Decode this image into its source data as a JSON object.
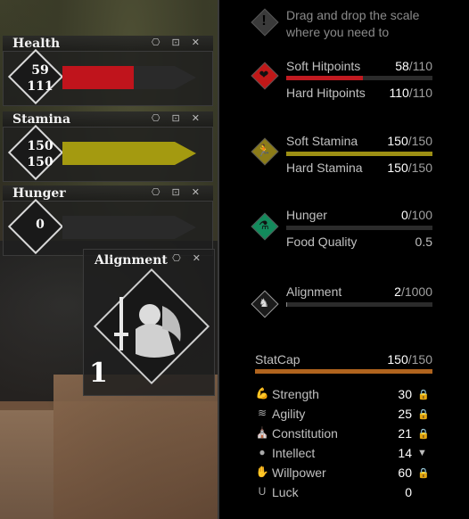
{
  "hud": {
    "health": {
      "title": "Health",
      "current": "59",
      "max": "111",
      "fill_fraction": 0.53,
      "color": "#c0141c"
    },
    "stamina": {
      "title": "Stamina",
      "current": "150",
      "max": "150",
      "fill_fraction": 1.0,
      "color": "#a49a10"
    },
    "hunger": {
      "title": "Hunger",
      "value": "0",
      "fill_fraction": 0.0,
      "color": "#2f2f2f"
    },
    "alignment": {
      "title": "Alignment",
      "value": "1"
    },
    "widget_icons": "⎔ ⊡ ✕"
  },
  "panel": {
    "hint": "Drag and drop the scale\nwhere you need to",
    "health": {
      "soft_label": "Soft Hitpoints",
      "soft_cur": "58",
      "soft_max": "/110",
      "hard_label": "Hard Hitpoints",
      "hard_cur": "110",
      "hard_max": "/110",
      "fill_fraction": 0.527,
      "color": "#c11a20",
      "gem_color": "#c01818"
    },
    "stamina": {
      "soft_label": "Soft Stamina",
      "soft_cur": "150",
      "soft_max": "/150",
      "hard_label": "Hard Stamina",
      "hard_cur": "150",
      "hard_max": "/150",
      "fill_fraction": 1.0,
      "color": "#9d8f14",
      "gem_color": "#8c7c18"
    },
    "hunger": {
      "label": "Hunger",
      "cur": "0",
      "max": "/100",
      "quality_label": "Food Quality",
      "quality_value": "0.5",
      "fill_fraction": 0.0,
      "gem_color": "#138a5c"
    },
    "alignment": {
      "label": "Alignment",
      "cur": "2",
      "max": "/1000",
      "fill_fraction": 0.002
    },
    "statcap": {
      "label": "StatCap",
      "cur": "150",
      "max": "/150",
      "fill_fraction": 1.0,
      "color": "#b0641e"
    },
    "attributes": [
      {
        "icon": "strength-icon",
        "glyph": "💪",
        "name": "Strength",
        "value": "30",
        "mode": "lock"
      },
      {
        "icon": "agility-icon",
        "glyph": "≋",
        "name": "Agility",
        "value": "25",
        "mode": "lock"
      },
      {
        "icon": "constitution-icon",
        "glyph": "⛪",
        "name": "Constitution",
        "value": "21",
        "mode": "lock"
      },
      {
        "icon": "intellect-icon",
        "glyph": "●",
        "name": "Intellect",
        "value": "14",
        "mode": "down"
      },
      {
        "icon": "willpower-icon",
        "glyph": "✋",
        "name": "Willpower",
        "value": "60",
        "mode": "lock"
      },
      {
        "icon": "luck-icon",
        "glyph": "U",
        "name": "Luck",
        "value": "0",
        "mode": "none"
      }
    ]
  }
}
